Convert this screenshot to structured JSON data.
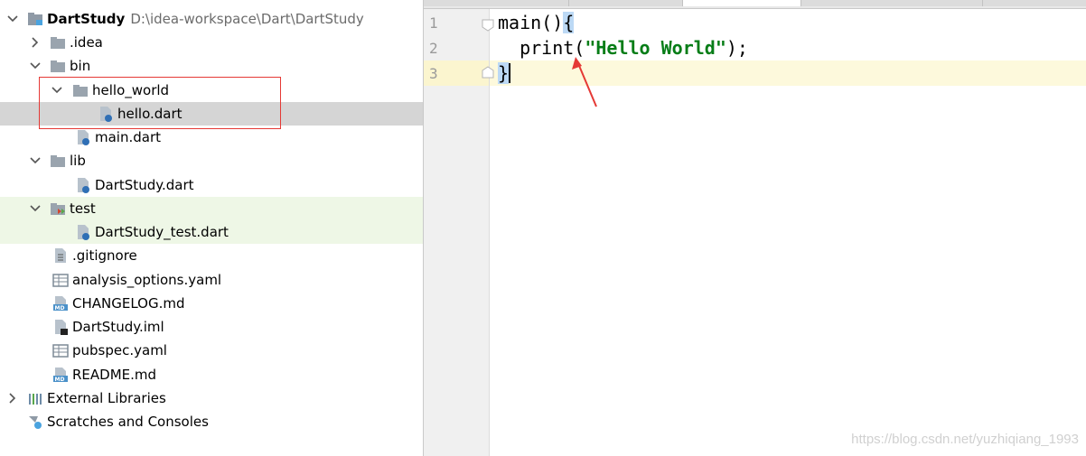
{
  "project": {
    "root_name": "DartStudy",
    "root_path": "D:\\idea-workspace\\Dart\\DartStudy",
    "items": [
      {
        "label": ".idea"
      },
      {
        "label": "bin"
      },
      {
        "label": "hello_world"
      },
      {
        "label": "hello.dart"
      },
      {
        "label": "main.dart"
      },
      {
        "label": "lib"
      },
      {
        "label": "DartStudy.dart"
      },
      {
        "label": "test"
      },
      {
        "label": "DartStudy_test.dart"
      },
      {
        "label": ".gitignore"
      },
      {
        "label": "analysis_options.yaml"
      },
      {
        "label": "CHANGELOG.md"
      },
      {
        "label": "DartStudy.iml"
      },
      {
        "label": "pubspec.yaml"
      },
      {
        "label": "README.md"
      },
      {
        "label": "External Libraries"
      },
      {
        "label": "Scratches and Consoles"
      }
    ]
  },
  "editor": {
    "line_numbers": [
      "1",
      "2",
      "3"
    ],
    "line1": {
      "fn": "main()",
      "brace": "{"
    },
    "line2": {
      "indent": "  ",
      "call": "print(",
      "string": "\"Hello World\"",
      "end": ");"
    },
    "line3": {
      "brace": "}"
    }
  },
  "watermark": "https://blog.csdn.net/yuzhiqiang_1993",
  "colors": {
    "selection": "#d5d5d5",
    "test_folder_bg": "#eef7e6",
    "string": "#067d17",
    "annotation": "#e53935",
    "caret_line": "#fdf9dc"
  }
}
